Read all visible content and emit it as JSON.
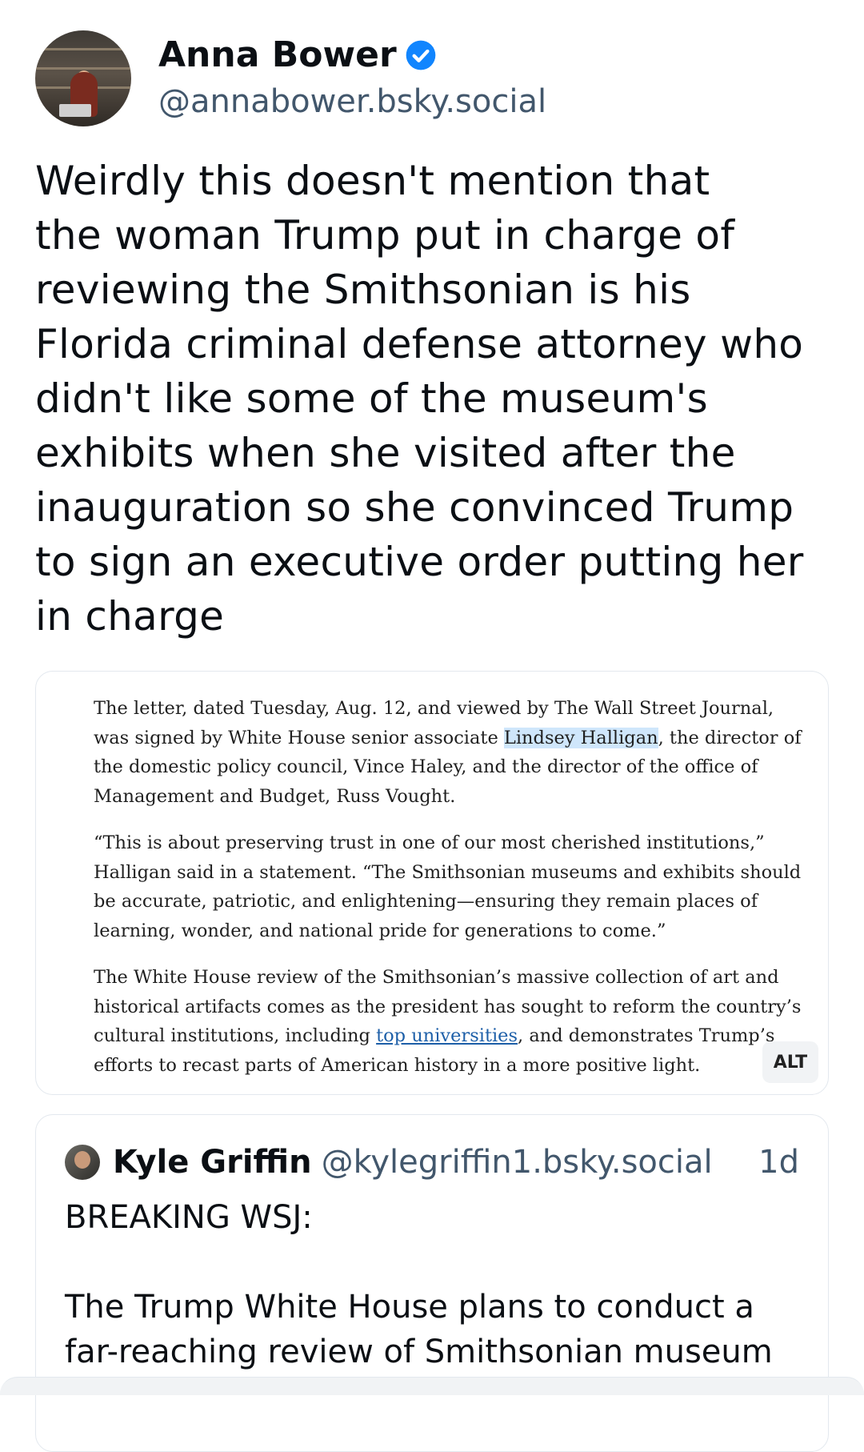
{
  "author": {
    "display_name": "Anna Bower",
    "handle": "@annabower.bsky.social"
  },
  "post": {
    "text": "Weirdly this doesn't mention that\nthe woman Trump put in charge of\nreviewing the Smithsonian is his\nFlorida criminal defense attorney who\ndidn't like some of the museum's\nexhibits when she visited after the\ninauguration so she convinced Trump\nto sign an executive order putting her\nin charge"
  },
  "image": {
    "p1_before": "The letter, dated Tuesday, Aug. 12, and viewed by The Wall Street Journal, was signed by White House senior associate ",
    "p1_highlight": "Lindsey Halligan",
    "p1_after": ", the director of the domestic policy council, Vince Haley, and the director of the office of Management and Budget, Russ Vought.",
    "p2": "“This is about preserving trust in one of our most cherished institutions,” Halligan said in a statement. “The Smithsonian museums and exhibits should be accurate, patriotic, and enlightening—ensuring they remain places of learning, wonder, and national pride for generations to come.”",
    "p3_before": "The White House review of the Smithsonian’s massive collection of art and historical artifacts comes as the president has sought to reform the country’s cultural institutions, including ",
    "p3_link": "top universities",
    "p3_after": ", and demonstrates Trump’s efforts to recast parts of American history in a more positive light.",
    "alt_label": "ALT"
  },
  "quote": {
    "display_name": "Kyle Griffin",
    "handle": "@kylegriffin1.bsky.social",
    "time": "1d",
    "text": "BREAKING WSJ:\n\nThe Trump White House plans to conduct a\nfar-reaching review of Smithsonian museum"
  },
  "colors": {
    "verified": "#1185fe",
    "secondary_text": "#42576c",
    "link": "#1d5fa8",
    "highlight": "#cfe6fb"
  },
  "icons": {
    "verified": "verified-check-icon"
  }
}
